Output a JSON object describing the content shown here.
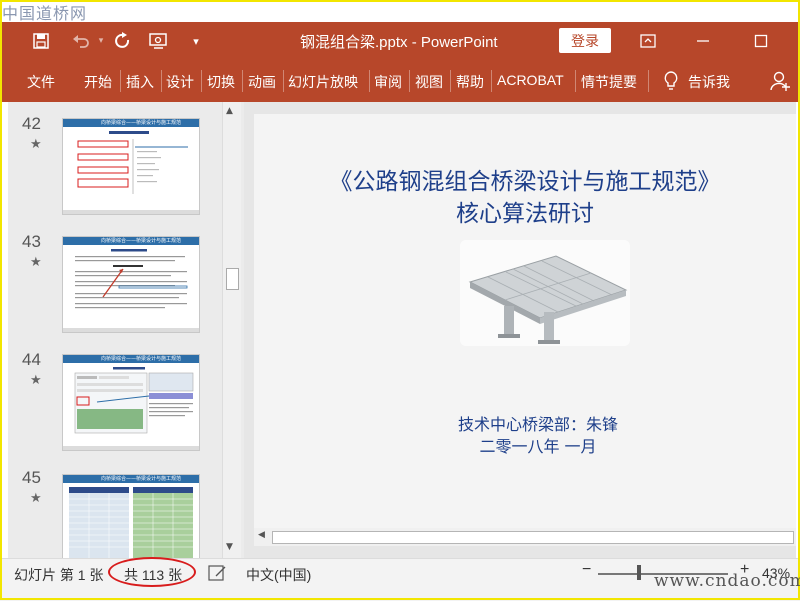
{
  "watermark_top": "中国道桥网",
  "watermark_bottom": "www.cndao.com",
  "titlebar": {
    "filename": "钢混组合梁.pptx",
    "separator": "-",
    "app": "PowerPoint",
    "login_label": "登录",
    "icons": [
      "save-icon",
      "undo-icon",
      "redo-icon",
      "present-icon",
      "customize-icon"
    ]
  },
  "ribbon": {
    "tabs": [
      "文件",
      "开始",
      "插入",
      "设计",
      "切换",
      "动画",
      "幻灯片放映",
      "审阅",
      "视图",
      "帮助",
      "ACROBAT",
      "情节提要"
    ],
    "tell_me": "告诉我"
  },
  "thumbnails": [
    {
      "number": "42",
      "star": "★",
      "header": "向桥梁综合——桥梁设计与施工规范"
    },
    {
      "number": "43",
      "star": "★",
      "header": "向桥梁综合——桥梁设计与施工规范"
    },
    {
      "number": "44",
      "star": "★",
      "header": "向桥梁综合——桥梁设计与施工规范"
    },
    {
      "number": "45",
      "star": "★",
      "header": "向桥梁综合——桥梁设计与施工规范"
    }
  ],
  "slide": {
    "title_line1": "《公路钢混组合桥梁设计与施工规范》",
    "title_line2": "核心算法研讨",
    "author_line1": "技术中心桥梁部：朱锋",
    "author_line2": "二零一八年 一月"
  },
  "statusbar": {
    "slide_info": "幻灯片 第 1 张",
    "total_slides": "共 113 张",
    "language": "中文(中国)",
    "zoom_minus": "−",
    "zoom_plus": "+",
    "zoom_percent": "43%",
    "zoom_level": 43
  },
  "colors": {
    "accent": "#b7472a",
    "slide_text": "#1e3f8a",
    "highlight": "#d81c1c"
  }
}
